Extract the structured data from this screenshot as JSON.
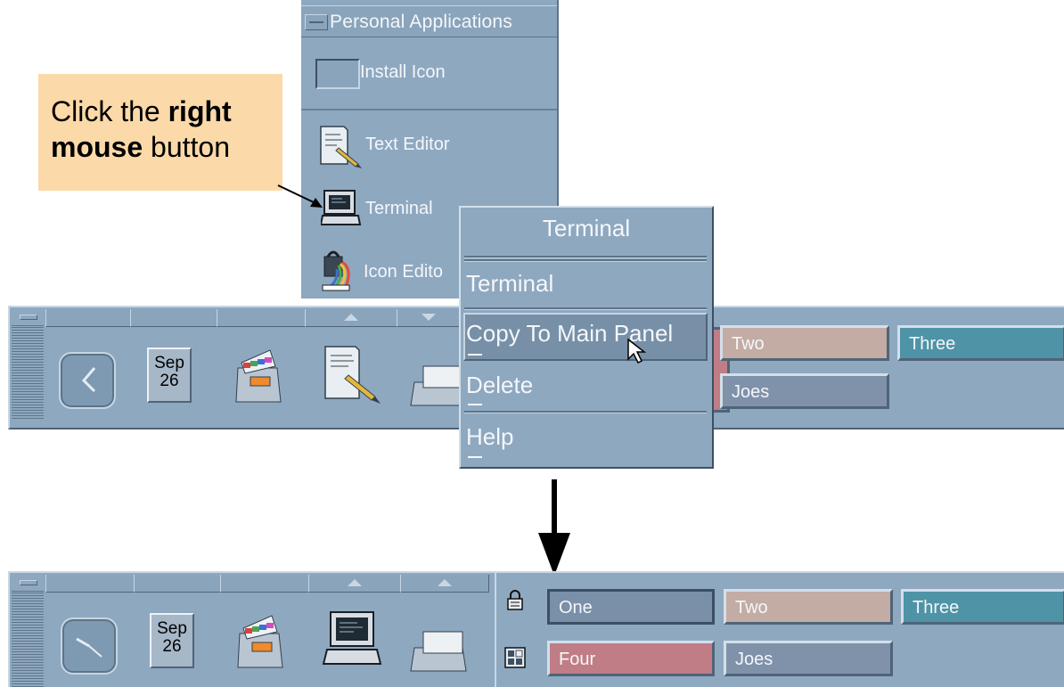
{
  "subpanel": {
    "title": "Personal Applications",
    "items": [
      {
        "label": "Install Icon",
        "icon": "install-icon-box"
      },
      {
        "label": "Text Editor",
        "icon": "text-editor-icon"
      },
      {
        "label": "Terminal",
        "icon": "terminal-icon"
      },
      {
        "label": "Icon Edito",
        "icon": "icon-editor-icon"
      }
    ]
  },
  "note": {
    "part1": "Click the ",
    "bold1": "right",
    "bold2": "mouse",
    "part2": " button"
  },
  "popup_menu": {
    "title": "Terminal",
    "items": [
      "Terminal",
      "Copy To Main Panel",
      "Delete",
      "Help"
    ]
  },
  "panel_before": {
    "calendar_month": "Sep",
    "calendar_day": "26",
    "workspaces": [
      "Two",
      "Three",
      "Joes"
    ]
  },
  "panel_after": {
    "calendar_month": "Sep",
    "calendar_day": "26",
    "workspaces": [
      "One",
      "Two",
      "Three",
      "Four",
      "Joes"
    ]
  },
  "colors": {
    "panel": "#8ea8c0",
    "note": "#fbd9a8",
    "ws_one": "#7a8fa8",
    "ws_two": "#c3aca4",
    "ws_three": "#4f93a6",
    "ws_four": "#c07d86",
    "ws_joes": "#7f92aa"
  }
}
